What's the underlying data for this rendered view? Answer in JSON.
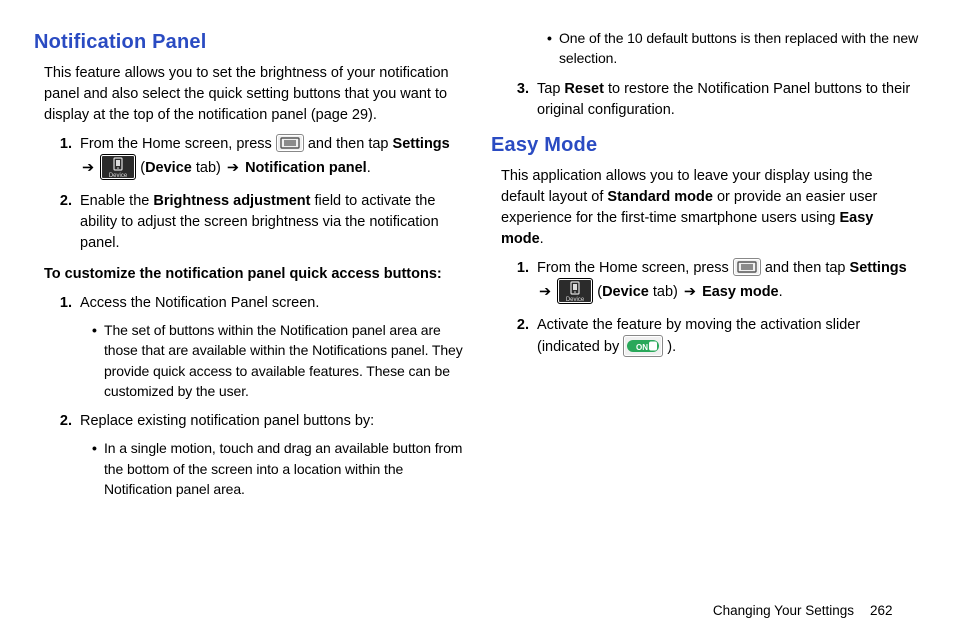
{
  "left": {
    "heading": "Notification Panel",
    "intro": "This feature allows you to set the brightness of your notification panel and also select the quick setting buttons that you want to display at the top of the notification panel (page 29).",
    "steps_a": [
      {
        "pre": "From the Home screen, press ",
        "mid": " and then tap ",
        "seg_settings": "Settings",
        "seg_arrow1": " ➔ ",
        "seg_paren_open": " (",
        "seg_device": "Device",
        "seg_tab": " tab) ",
        "seg_arrow2": "➔ ",
        "seg_target": "Notification panel",
        "seg_dot": "."
      },
      {
        "text_a": "Enable the ",
        "bold": "Brightness adjustment",
        "text_b": " field to activate the ability to adjust the screen brightness via the notification panel."
      }
    ],
    "subhead": "To customize the notification panel quick access buttons:",
    "steps_b": [
      {
        "text": "Access the Notification Panel screen.",
        "bullets": [
          "The set of buttons within the Notification panel area are those that are available within the Notifications panel. They provide quick access to available features. These can be customized by the user."
        ]
      },
      {
        "text": "Replace existing notification panel buttons by:",
        "bullets": [
          "In a single motion, touch and drag an available button from the bottom of the screen into a location within the Notification panel area."
        ]
      }
    ]
  },
  "right": {
    "cont_bullets": [
      "One of the 10 default buttons is then replaced with the new selection."
    ],
    "steps_c": [
      {
        "text_a": "Tap ",
        "bold": "Reset",
        "text_b": " to restore the Notification Panel buttons to their original configuration."
      }
    ],
    "heading": "Easy Mode",
    "intro_a": "This application allows you to leave your display using the default layout of ",
    "intro_bold1": "Standard mode",
    "intro_b": " or provide an easier user experience for the first-time smartphone users using ",
    "intro_bold2": "Easy mode",
    "intro_c": ".",
    "steps_d": [
      {
        "pre": "From the Home screen, press ",
        "mid": " and then tap ",
        "seg_settings": "Settings",
        "seg_arrow1": " ➔ ",
        "seg_paren_open": " (",
        "seg_device": "Device",
        "seg_tab": " tab) ",
        "seg_arrow2": "➔ ",
        "seg_target": "Easy mode",
        "seg_dot": "."
      },
      {
        "text_a": "Activate the feature by moving the activation slider (indicated by ",
        "text_b": ")."
      }
    ]
  },
  "footer": {
    "section": "Changing Your Settings",
    "page": "262"
  },
  "icons": {
    "menu": "menu-button-icon",
    "device": "device-tab-icon",
    "toggle": "toggle-on-icon",
    "device_label": "Device",
    "toggle_label": "ON"
  }
}
